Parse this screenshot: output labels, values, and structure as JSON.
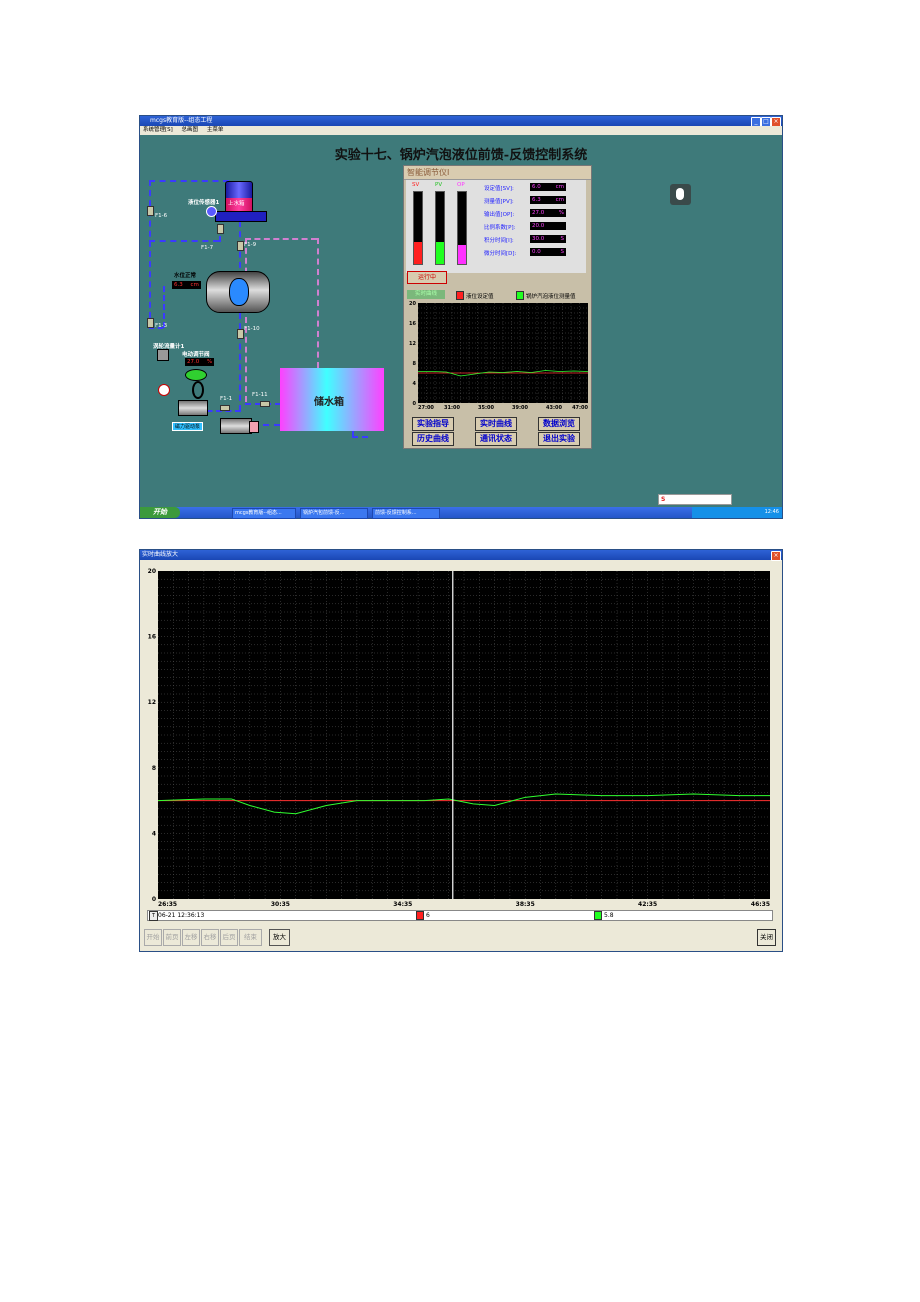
{
  "window1": {
    "title": "mcgs教育版--组态工程",
    "menu": [
      "系统管理[S]",
      "总画图",
      "主菜单"
    ],
    "heading": "实验十七、锅炉汽泡液位前馈-反馈控制系统",
    "process": {
      "tank_label": "上水箱",
      "sensor_label": "液位传感器1",
      "drum_label": "水位正常",
      "drum_value": "6.3",
      "drum_unit": "cm",
      "flowmeter_label": "涡轮流量计1",
      "valve_label": "电动调节阀",
      "valve_value": "27.0",
      "valve_unit": "%",
      "pump_label": "磁力驱动泵",
      "reservoir_label": "储水箱",
      "valves": [
        "F1-6",
        "F1-7",
        "F1-9",
        "F1-3",
        "F1-10",
        "F1-1",
        "F1-11"
      ]
    },
    "controller": {
      "title": "智能调节仪Ⅰ",
      "bars": [
        {
          "name": "SV",
          "color": "#ff2020",
          "fill": 0.3
        },
        {
          "name": "PV",
          "color": "#20ff20",
          "fill": 0.3
        },
        {
          "name": "OP",
          "color": "#ff30ff",
          "fill": 0.27
        }
      ],
      "params": [
        {
          "label": "设定值[SV]:",
          "value": "6.0",
          "unit": "cm"
        },
        {
          "label": "测量值[PV]:",
          "value": "6.3",
          "unit": "cm"
        },
        {
          "label": "输出值[OP]:",
          "value": "27.0",
          "unit": "%"
        },
        {
          "label": "比例系数[P]:",
          "value": "20.0",
          "unit": ""
        },
        {
          "label": "积分时间[I]:",
          "value": "30.0",
          "unit": "S"
        },
        {
          "label": "微分时间[D]:",
          "value": "0.0",
          "unit": "S"
        }
      ],
      "status": "运行中",
      "legend_left": "实时曲线",
      "legend_sv": "液位设定值",
      "legend_pv": "锅炉汽泡液位测量值",
      "buttons": [
        "实验指导",
        "实时曲线",
        "数据浏览",
        "历史曲线",
        "通讯状态",
        "退出实验"
      ]
    },
    "taskbar": {
      "start": "开始",
      "items": [
        "mcgs教育版--组态...",
        "锅炉汽包前馈-反...",
        "前馈-反馈控制系..."
      ],
      "clock": "12:46"
    }
  },
  "window2": {
    "title": "实时曲线放大",
    "cursor_time": "06-21 12:36:13",
    "sv_value": "6",
    "pv_value": "5.8",
    "nav_buttons": [
      "开始",
      "前页",
      "左移",
      "右移",
      "后页",
      "结束"
    ],
    "zoom_button": "放大",
    "close_button": "关闭"
  },
  "chart_data": [
    {
      "type": "line",
      "title": "",
      "x_ticks": [
        "27:00",
        "31:00",
        "35:00",
        "39:00",
        "43:00",
        "47:00"
      ],
      "ylim": [
        0,
        20
      ],
      "y_ticks": [
        0,
        4,
        8,
        12,
        16,
        20
      ],
      "grid": true,
      "series": [
        {
          "name": "液位设定值",
          "color": "#ff3030",
          "y": [
            6,
            6,
            6,
            6,
            6,
            6,
            6,
            6,
            6,
            6,
            6,
            6,
            6
          ]
        },
        {
          "name": "锅炉汽泡液位测量值",
          "color": "#30ff30",
          "y": [
            6.3,
            6.3,
            6.2,
            5.4,
            5.8,
            6.2,
            6.1,
            6.3,
            6.1,
            6.5,
            6.3,
            6.4,
            6.3
          ]
        }
      ]
    },
    {
      "type": "line",
      "title": "",
      "x_ticks": [
        "26:35",
        "30:35",
        "34:35",
        "38:35",
        "42:35",
        "46:35"
      ],
      "ylim": [
        0,
        20
      ],
      "y_ticks": [
        0,
        4,
        8,
        12,
        16,
        20
      ],
      "grid": true,
      "cursor_x": "36:13",
      "series": [
        {
          "name": "液位设定值",
          "color": "#ff3030",
          "x": [
            0,
            20
          ],
          "y": [
            6,
            6
          ]
        },
        {
          "name": "锅炉汽泡液位测量值",
          "color": "#30ff30",
          "x": [
            0,
            1.5,
            2.4,
            3.0,
            3.8,
            4.5,
            5.5,
            6.5,
            7.5,
            8.7,
            9.5,
            10.3,
            11.0,
            12.0,
            13.0,
            14.5,
            16.0,
            17.5,
            19.0,
            20.0
          ],
          "y": [
            6.0,
            6.1,
            6.1,
            5.7,
            5.3,
            5.2,
            5.7,
            6.0,
            6.0,
            6.0,
            6.1,
            5.8,
            5.7,
            6.2,
            6.4,
            6.3,
            6.3,
            6.4,
            6.3,
            6.3
          ]
        }
      ]
    }
  ]
}
